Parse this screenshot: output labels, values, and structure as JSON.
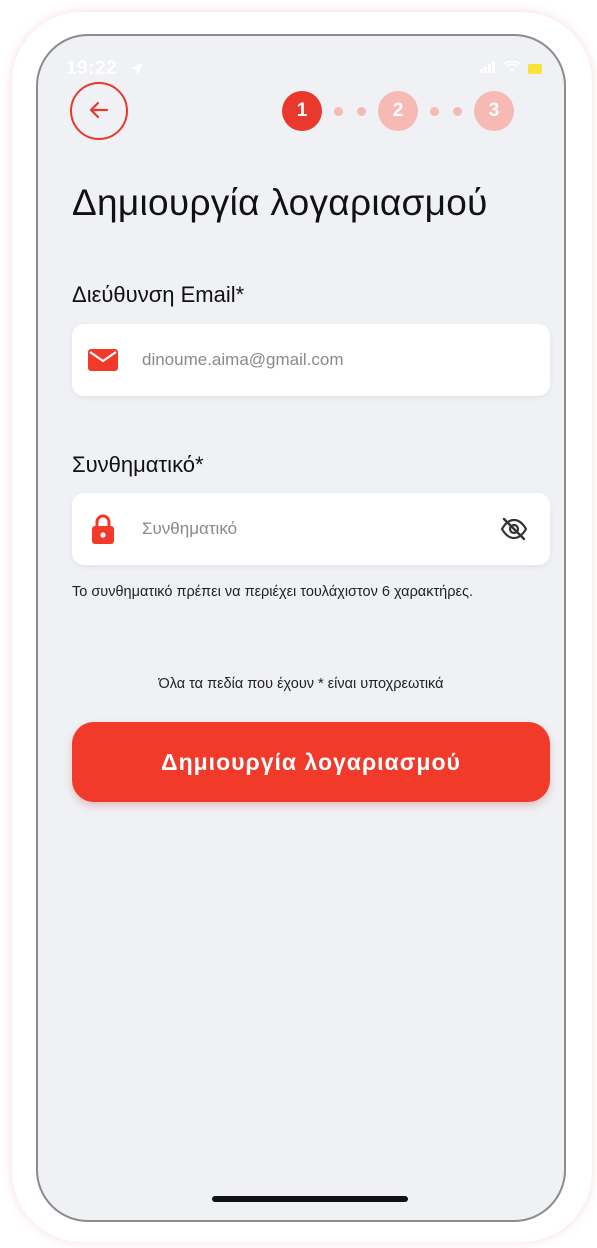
{
  "status_bar": {
    "time": "19:22",
    "location_icon": "location-arrow-icon",
    "signal_icon": "signal-icon",
    "wifi_icon": "wifi-icon",
    "battery_icon": "battery-icon"
  },
  "navigation": {
    "back_icon": "arrow-left-icon"
  },
  "stepper": {
    "steps": [
      "1",
      "2",
      "3"
    ],
    "current": 1
  },
  "page": {
    "title": "Δημιουργία λογαριασμού"
  },
  "email": {
    "label": "Διεύθυνση Email*",
    "placeholder": "dinoume.aima@gmail.com",
    "value": "",
    "icon": "mail-icon"
  },
  "password": {
    "label": "Συνθηματικό*",
    "placeholder": "Συνθηματικό",
    "value": "",
    "icon": "lock-icon",
    "toggle_icon": "eye-off-icon",
    "hint": "Το συνθηματικό πρέπει να περιέχει τουλάχιστον 6 χαρακτήρες."
  },
  "required_note": "Όλα τα πεδία που έχουν * είναι υποχρεωτικά",
  "submit_button": {
    "label": "Δημιουργία λογαριασμού"
  },
  "colors": {
    "accent": "#e8392c",
    "accent_light": "#f7b9b3",
    "button": "#f23a2a",
    "background": "#eff1f5"
  }
}
